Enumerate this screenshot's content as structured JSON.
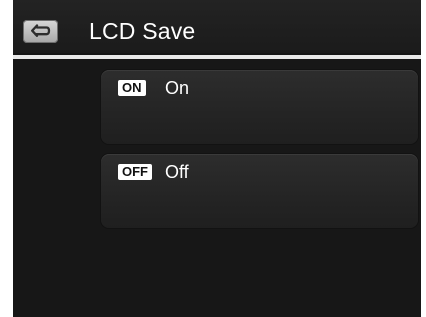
{
  "header": {
    "title": "LCD Save",
    "back_icon": "back-arrow-icon"
  },
  "options": [
    {
      "badge": "ON",
      "label": "On"
    },
    {
      "badge": "OFF",
      "label": "Off"
    }
  ],
  "colors": {
    "background": "#161616",
    "header": "#1f1f1f",
    "divider": "#e9e9e9",
    "option_background": "#2a2a2a",
    "text": "#ffffff",
    "badge_background": "#ffffff",
    "badge_text": "#111111"
  }
}
